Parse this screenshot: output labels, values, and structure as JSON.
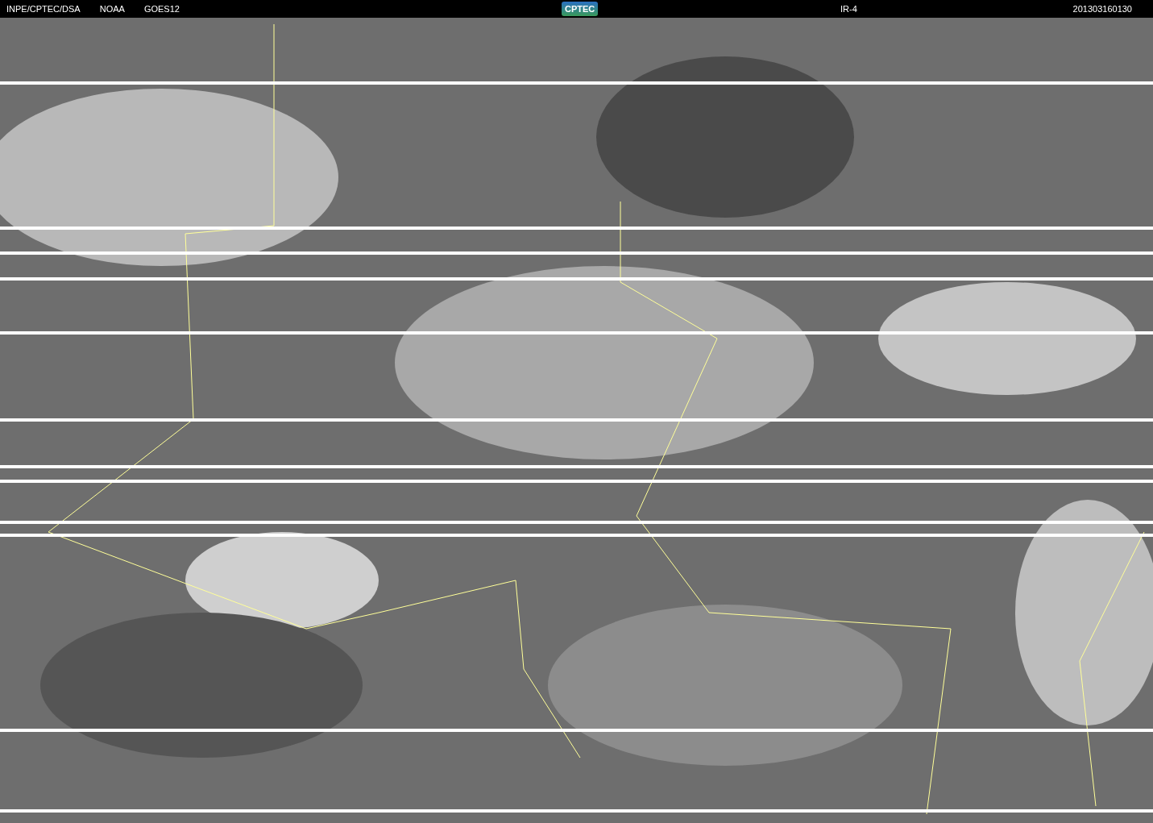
{
  "header": {
    "labels": [
      "INPE/CPTEC/DSA",
      "NOAA",
      "GOES12"
    ],
    "logo": "CPTEC",
    "channel": "IR-4",
    "timestamp": "201303160130"
  }
}
